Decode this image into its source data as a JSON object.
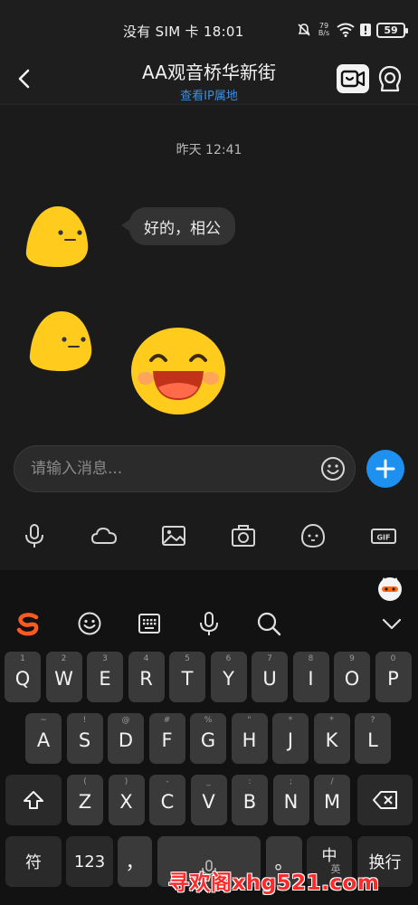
{
  "status_bar": {
    "carrier_time": "没有 SIM 卡 18:01",
    "net_speed_value": "79",
    "net_speed_unit": "B/s",
    "battery": "59",
    "icons": [
      "mute-icon",
      "wifi-icon",
      "alert-icon",
      "battery-icon"
    ]
  },
  "header": {
    "title": "AA观音桥华新街",
    "subtitle": "查看IP属地",
    "icons": [
      "back-arrow-icon",
      "video-call-icon",
      "profile-icon"
    ]
  },
  "chat": {
    "timestamp": "昨天 12:41",
    "messages": [
      {
        "type": "text",
        "content": "好的，相公"
      },
      {
        "type": "sticker",
        "content": "laughing-face-emoji"
      }
    ]
  },
  "input": {
    "placeholder": "请输入消息..."
  },
  "tools": [
    "voice-icon",
    "cloud-icon",
    "image-icon",
    "camera-icon",
    "sticker-icon",
    "gif-icon"
  ],
  "keyboard": {
    "toolbar_icons": [
      "sogou-logo",
      "emoji-icon",
      "keyboard-icon",
      "mic-icon",
      "search-icon",
      "collapse-icon"
    ],
    "row1": [
      {
        "main": "Q",
        "hint": "1"
      },
      {
        "main": "W",
        "hint": "2"
      },
      {
        "main": "E",
        "hint": "3"
      },
      {
        "main": "R",
        "hint": "4"
      },
      {
        "main": "T",
        "hint": "5"
      },
      {
        "main": "Y",
        "hint": "6"
      },
      {
        "main": "U",
        "hint": "7"
      },
      {
        "main": "I",
        "hint": "8"
      },
      {
        "main": "O",
        "hint": "9"
      },
      {
        "main": "P",
        "hint": "0"
      }
    ],
    "row2": [
      {
        "main": "A",
        "hint": "~"
      },
      {
        "main": "S",
        "hint": "!"
      },
      {
        "main": "D",
        "hint": "@"
      },
      {
        "main": "F",
        "hint": "#"
      },
      {
        "main": "G",
        "hint": "%"
      },
      {
        "main": "H",
        "hint": "\""
      },
      {
        "main": "J",
        "hint": "*"
      },
      {
        "main": "K",
        "hint": "*"
      },
      {
        "main": "L",
        "hint": "?"
      }
    ],
    "row3": [
      {
        "main": "Z",
        "hint": "("
      },
      {
        "main": "X",
        "hint": ")"
      },
      {
        "main": "C",
        "hint": "-"
      },
      {
        "main": "V",
        "hint": "_"
      },
      {
        "main": "B",
        "hint": ":"
      },
      {
        "main": "N",
        "hint": ";"
      },
      {
        "main": "M",
        "hint": "/"
      }
    ],
    "bottom": {
      "symbol": "符",
      "numbers": "123",
      "comma": "，",
      "period": "。",
      "lang_main": "中",
      "lang_sub": "英",
      "newline": "换行"
    }
  },
  "watermark": "寻欢阁xhg521.com",
  "colors": {
    "accent": "#1e90f0",
    "link": "#3c8fe0",
    "sogou": "#ff5a1f",
    "emoji_yellow": "#ffcc1e"
  }
}
